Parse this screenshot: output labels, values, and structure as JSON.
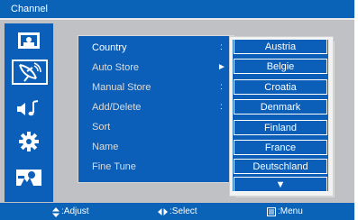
{
  "window": {
    "title": "Channel"
  },
  "sidebar": {
    "items": [
      {
        "icon": "picture-icon"
      },
      {
        "icon": "satellite-dish-icon",
        "selected": true
      },
      {
        "icon": "sound-icon"
      },
      {
        "icon": "gear-icon"
      },
      {
        "icon": "lock-icon"
      }
    ]
  },
  "menu": {
    "items": [
      {
        "label": "Country",
        "indicator": ":"
      },
      {
        "label": "Auto Store",
        "indicator": "►"
      },
      {
        "label": "Manual Store",
        "indicator": ":"
      },
      {
        "label": "Add/Delete",
        "indicator": ":"
      },
      {
        "label": "Sort",
        "indicator": ""
      },
      {
        "label": "Name",
        "indicator": ""
      },
      {
        "label": "Fine Tune",
        "indicator": ""
      }
    ]
  },
  "country_list": {
    "items": [
      "Austria",
      "Belgie",
      "Croatia",
      "Denmark",
      "Finland",
      "France",
      "Deutschland"
    ],
    "more_arrow": "▼"
  },
  "footer": {
    "adjust": ":Adjust",
    "select": ":Select",
    "menu": ":Menu"
  },
  "colors": {
    "primary_blue": "#0b5fb8",
    "panel_gray": "#bfc1c4",
    "text": "#ffffff"
  }
}
